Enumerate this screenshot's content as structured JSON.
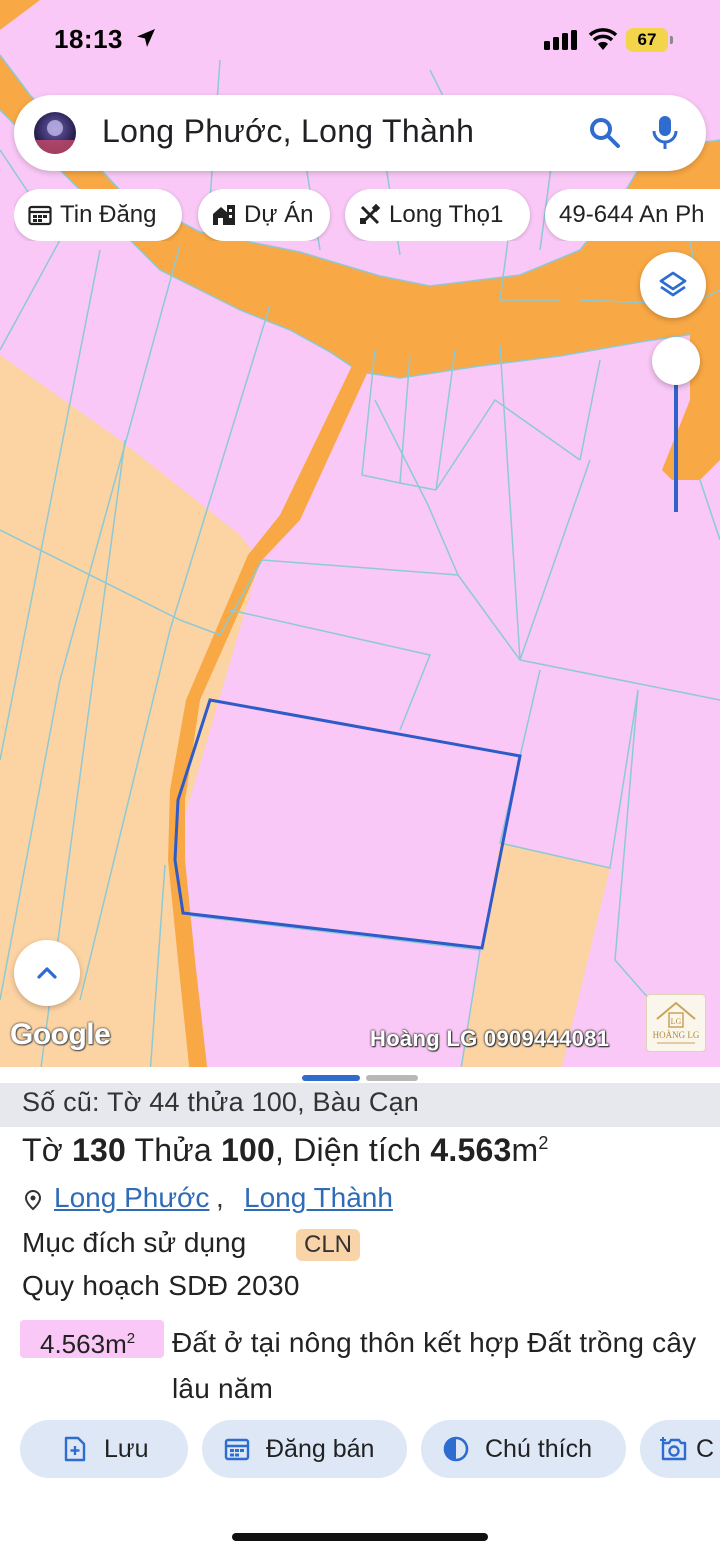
{
  "status_bar": {
    "time": "18:13",
    "battery": "67"
  },
  "search": {
    "query": "Long Phước, Long Thành"
  },
  "chips": [
    {
      "label": "Tin Đăng",
      "icon": "calendar-icon"
    },
    {
      "label": "Dự Án",
      "icon": "building-icon"
    },
    {
      "label": "Long Thọ1",
      "icon": "tools-icon"
    },
    {
      "label": "49-644 An Ph",
      "icon": ""
    }
  ],
  "map": {
    "google_label": "Google",
    "watermark": "Hoàng LG 0909444081",
    "logo_text": "HOÀNG LG",
    "colors": {
      "residential": "#f9c8f6",
      "perennial": "#fcd3a2",
      "road": "#f8a844",
      "selected_boundary": "#2f5bc8"
    }
  },
  "info_sheet": {
    "old_record": "Số cũ: Tờ 44 thửa 100, Bàu Cạn",
    "parcel": {
      "to_label": "Tờ",
      "to_value": "130",
      "thua_label": "Thửa",
      "thua_value": "100",
      "area_label": ", Diện tích",
      "area_value": "4.563",
      "area_unit": "m",
      "area_sup": "2"
    },
    "address": {
      "commune": "Long Phước",
      "separator": ",",
      "district": "Long Thành"
    },
    "purpose_label": "Mục đích sử dụng",
    "purpose_code": "CLN",
    "plan_label": "Quy hoạch SDĐ 2030",
    "plan_area": "4.563m",
    "plan_area_sup": "2",
    "plan_land_type": "Đất ở tại nông thôn kết hợp Đất trồng cây lâu năm"
  },
  "actions": [
    {
      "label": "Lưu",
      "icon": "save-icon"
    },
    {
      "label": "Đăng bán",
      "icon": "calendar-icon"
    },
    {
      "label": "Chú thích",
      "icon": "contrast-icon"
    },
    {
      "label": "C",
      "icon": "camera-icon"
    }
  ]
}
